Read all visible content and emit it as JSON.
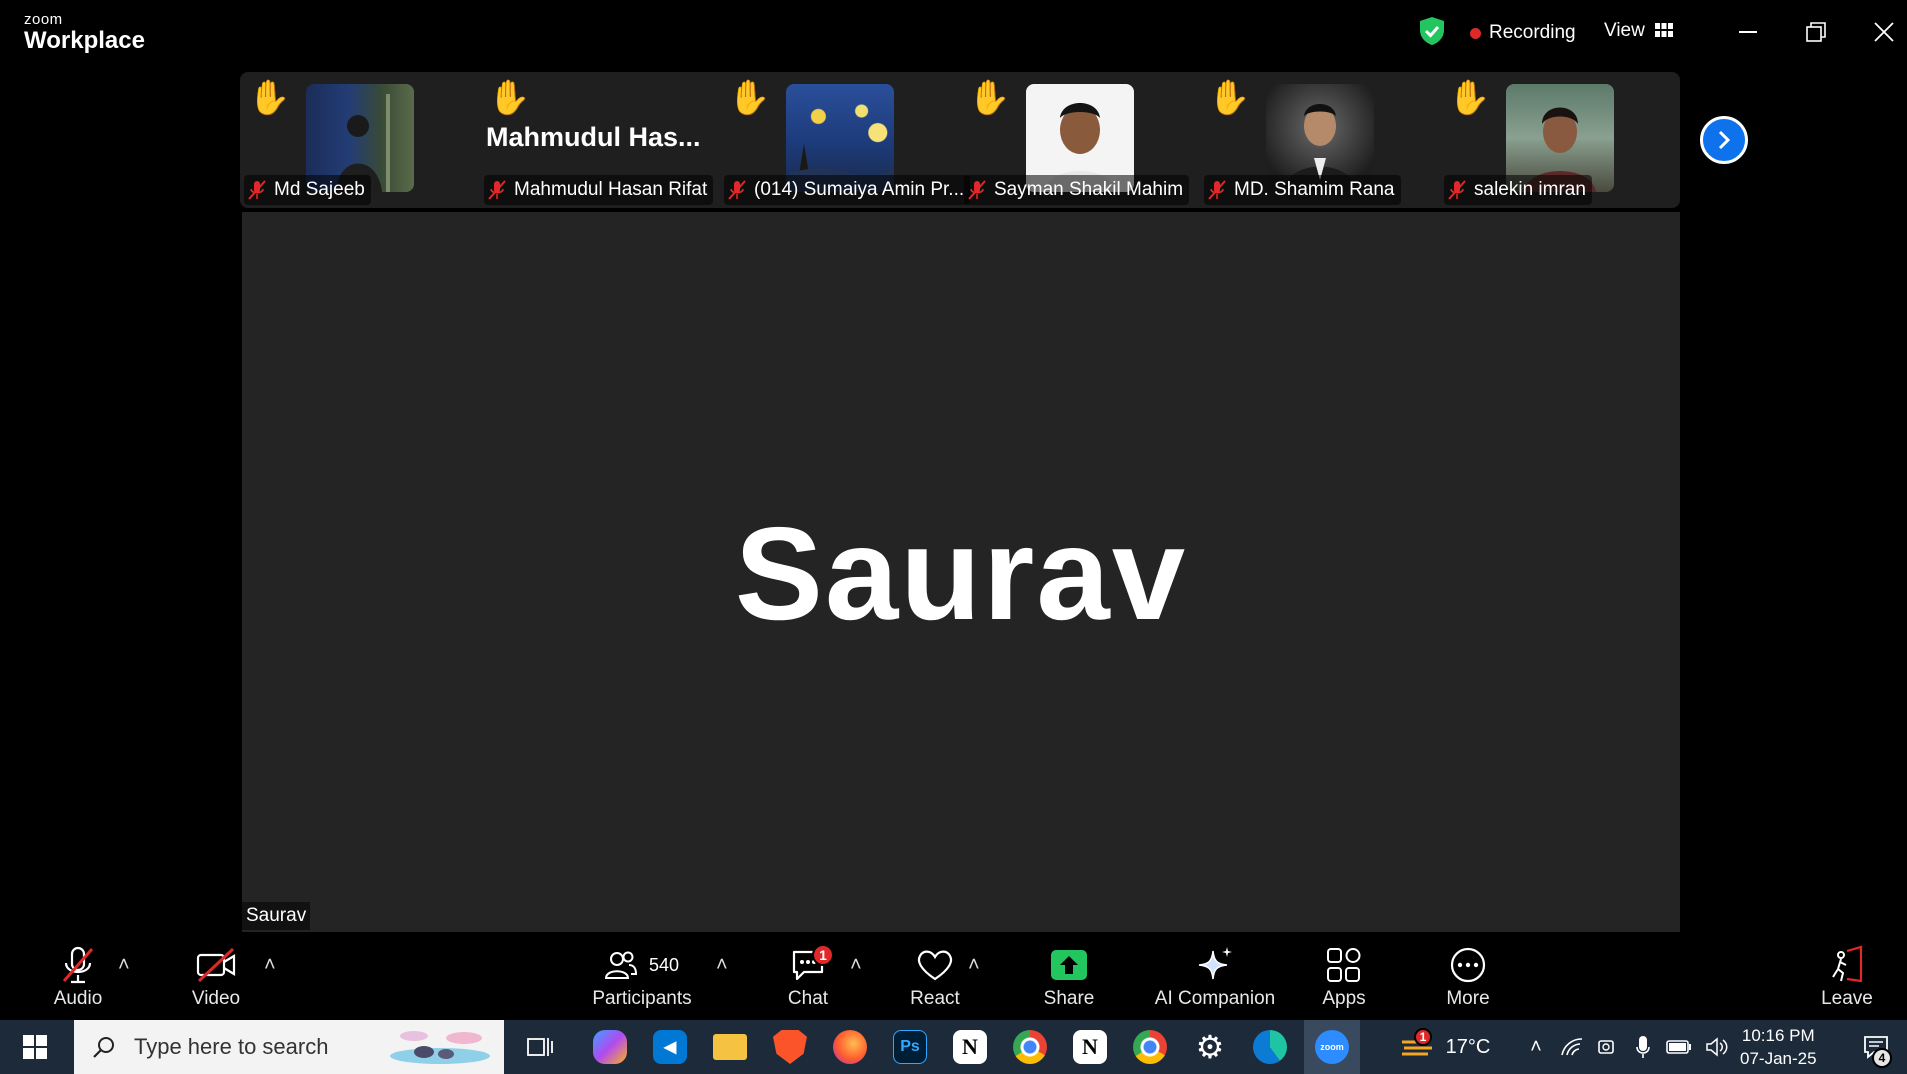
{
  "app": {
    "brand_top": "zoom",
    "brand_bottom": "Workplace"
  },
  "titlebar": {
    "recording_label": "Recording",
    "view_label": "View"
  },
  "participants_strip": [
    {
      "label": "Md Sajeeb",
      "hand_raised": true,
      "muted": true,
      "big_name": ""
    },
    {
      "label": "Mahmudul Hasan Rifat",
      "hand_raised": true,
      "muted": true,
      "big_name": "Mahmudul  Has..."
    },
    {
      "label": "(014) Sumaiya Amin Pr...",
      "hand_raised": true,
      "muted": true,
      "big_name": ""
    },
    {
      "label": "Sayman Shakil Mahim",
      "hand_raised": true,
      "muted": true,
      "big_name": ""
    },
    {
      "label": "MD. Shamim Rana",
      "hand_raised": true,
      "muted": true,
      "big_name": ""
    },
    {
      "label": "salekin imran",
      "hand_raised": true,
      "muted": true,
      "big_name": ""
    }
  ],
  "stage": {
    "center_name": "Saurav",
    "name_tag": "Saurav"
  },
  "toolbar": {
    "audio": "Audio",
    "video": "Video",
    "participants": "Participants",
    "participants_count": "540",
    "chat": "Chat",
    "chat_badge": "1",
    "react": "React",
    "share": "Share",
    "ai_companion": "AI Companion",
    "apps": "Apps",
    "more": "More",
    "leave": "Leave"
  },
  "taskbar": {
    "search_placeholder": "Type here to search",
    "weather_temp": "17°C",
    "weather_badge": "1",
    "time": "10:16 PM",
    "date": "07-Jan-25",
    "notifications_count": "4"
  },
  "colors": {
    "accent": "#0e72ed",
    "share_green": "#22c55e",
    "record_red": "#e02828",
    "stage_bg": "#242424"
  }
}
